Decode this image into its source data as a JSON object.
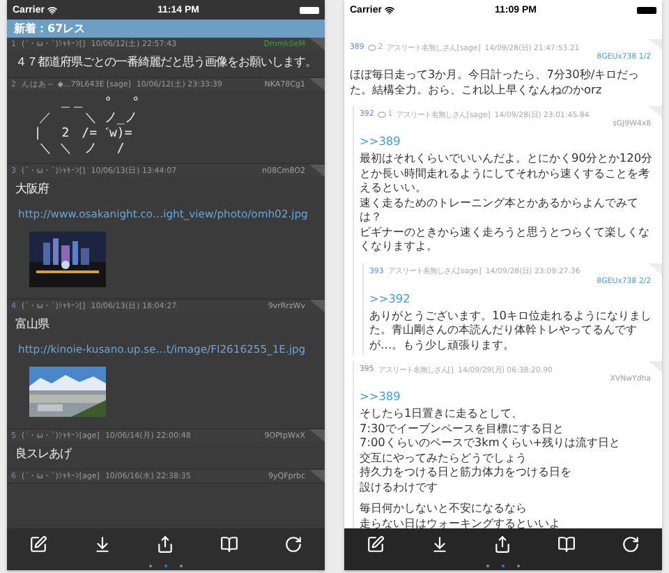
{
  "left_screen": {
    "status_bar": {
      "carrier": "Carrier",
      "time": "11:14 PM"
    },
    "banner": "新着：67レス",
    "posts": [
      {
        "number": "1",
        "name": "(´・ω・`)ｼｬｷｰﾝ[]",
        "date": "10/06/12(土) 22:57:43",
        "id": "Dmmk0eM",
        "id_highlighted": true,
        "blocks": [
          {
            "kind": "text",
            "text": "４７都道府県ごとの一番綺麗だと思う画像をお願いします。"
          }
        ]
      },
      {
        "number": "2",
        "name": "んはあ～ ◆...79L643E [sage]",
        "date": "10/06/12(土) 23:33:39",
        "id": "NKA78Cg1",
        "id_highlighted": false,
        "blocks": [
          {
            "kind": "art",
            "text": "　　 ＿＿ 　°　 °\n　／　　 ＼ ノ_ノ\n |　 2　/=゛w)=\n　＼ ＼　ノ　 /"
          }
        ]
      },
      {
        "number": "3",
        "name": "(´・ω・`)ｼｬｷｰﾝ[]",
        "date": "10/06/13(日) 13:44:07",
        "id": "n08Cm8O2",
        "id_highlighted": false,
        "blocks": [
          {
            "kind": "text",
            "text": "大阪府"
          },
          {
            "kind": "link",
            "text": "http://www.osakanight.co…ight_view/photo/omh02.jpg"
          },
          {
            "kind": "picture"
          }
        ]
      },
      {
        "number": "4",
        "name": "(´・ω・`)ｼｬｷｰﾝ[]",
        "date": "10/06/13(日) 18:04:27",
        "id": "9vrRrzWv",
        "id_highlighted": false,
        "blocks": [
          {
            "kind": "text",
            "text": "富山県"
          },
          {
            "kind": "link",
            "text": "http://kinoie-kusano.up.se…t/image/FI2616255_1E.jpg"
          },
          {
            "kind": "picture"
          }
        ]
      },
      {
        "number": "5",
        "name": "(´・ω・`)ｼｬｷｰﾝ[age]",
        "date": "10/06/14(月) 22:00:48",
        "id": "9OPtpWxX",
        "id_highlighted": false,
        "blocks": [
          {
            "kind": "text",
            "text": "良スレあげ"
          }
        ]
      },
      {
        "number": "6",
        "name": "(´・ω・`)ｼｬｷｰﾝ[age]",
        "date": "10/06/16(水) 22:38:35",
        "id": "9yQFprbc",
        "id_highlighted": false
      }
    ],
    "page_dots": [
      {
        "selected": false
      },
      {
        "selected": true
      },
      {
        "selected": false
      }
    ]
  },
  "right_screen": {
    "status_bar": {
      "carrier": "Carrier",
      "time": "11:09 PM"
    },
    "posts": [
      {
        "number": "389",
        "reply_count": "2",
        "name": "アスリート名無しさん[sage]",
        "date": "14/09/28(日) 21:47:53.21",
        "id": "8GEUx738 1/2",
        "id_highlighted": true,
        "paragraphs": [
          [
            "ほぼ毎日走って3か月。今日計ったら、7分30秒/キロだった。結構全力。おら、これ以上早くなんねのかorz"
          ]
        ],
        "children": [
          {
            "number": "392",
            "reply_count": "1",
            "name": "アスリート名無しさん[sage]",
            "date": "14/09/28(日) 23:01:45.84",
            "id": "sGJ9W4x8",
            "id_highlighted": false,
            "anchor": ">>389",
            "paragraphs": [
              [
                "最初はそれくらいでいいんだよ。とにかく90分とか120分とか長い時間走れるようにしてそれから速くすることを考えるといい。",
                "速く走るためのトレーニング本とかあるからよんでみては？",
                "ビギナーのときから速く走ろうと思うとつらくて楽しくなくなりますよ。"
              ]
            ],
            "children": [
              {
                "number": "393",
                "name": "アスリート名無しさん[sage]",
                "date": "14/09/28(日) 23:09:27.36",
                "id": "8GEUx738 2/2",
                "id_highlighted": true,
                "anchor": ">>392",
                "paragraphs": [
                  [
                    "ありがとうございます。10キロ位走れるようになりました。青山剛さんの本読んだり体幹トレやってるんですが…。もう少し頑張ります。"
                  ]
                ]
              }
            ]
          },
          {
            "number": "395",
            "name": "アスリート名無しさん[]",
            "date": "14/09/29(月) 06:38:20.90",
            "id": "XVNwYdha",
            "id_highlighted": false,
            "anchor": ">>389",
            "paragraphs": [
              [
                "そしたら1日置きに走るとして、",
                "7:30でイーブンペースを目標にする日と",
                "7:00くらいのペースで3kmくらい+残りは流す日と",
                "交互にやってみたらどうでしょう",
                "持久力をつける日と筋力体力をつける日を",
                "設けるわけです"
              ],
              [
                "毎日何かしないと不安になるなら",
                "走らない日はウォーキングするといいよ"
              ]
            ]
          }
        ]
      }
    ],
    "page_dots": [
      {
        "selected": false
      },
      {
        "selected": true
      },
      {
        "selected": false
      }
    ]
  }
}
